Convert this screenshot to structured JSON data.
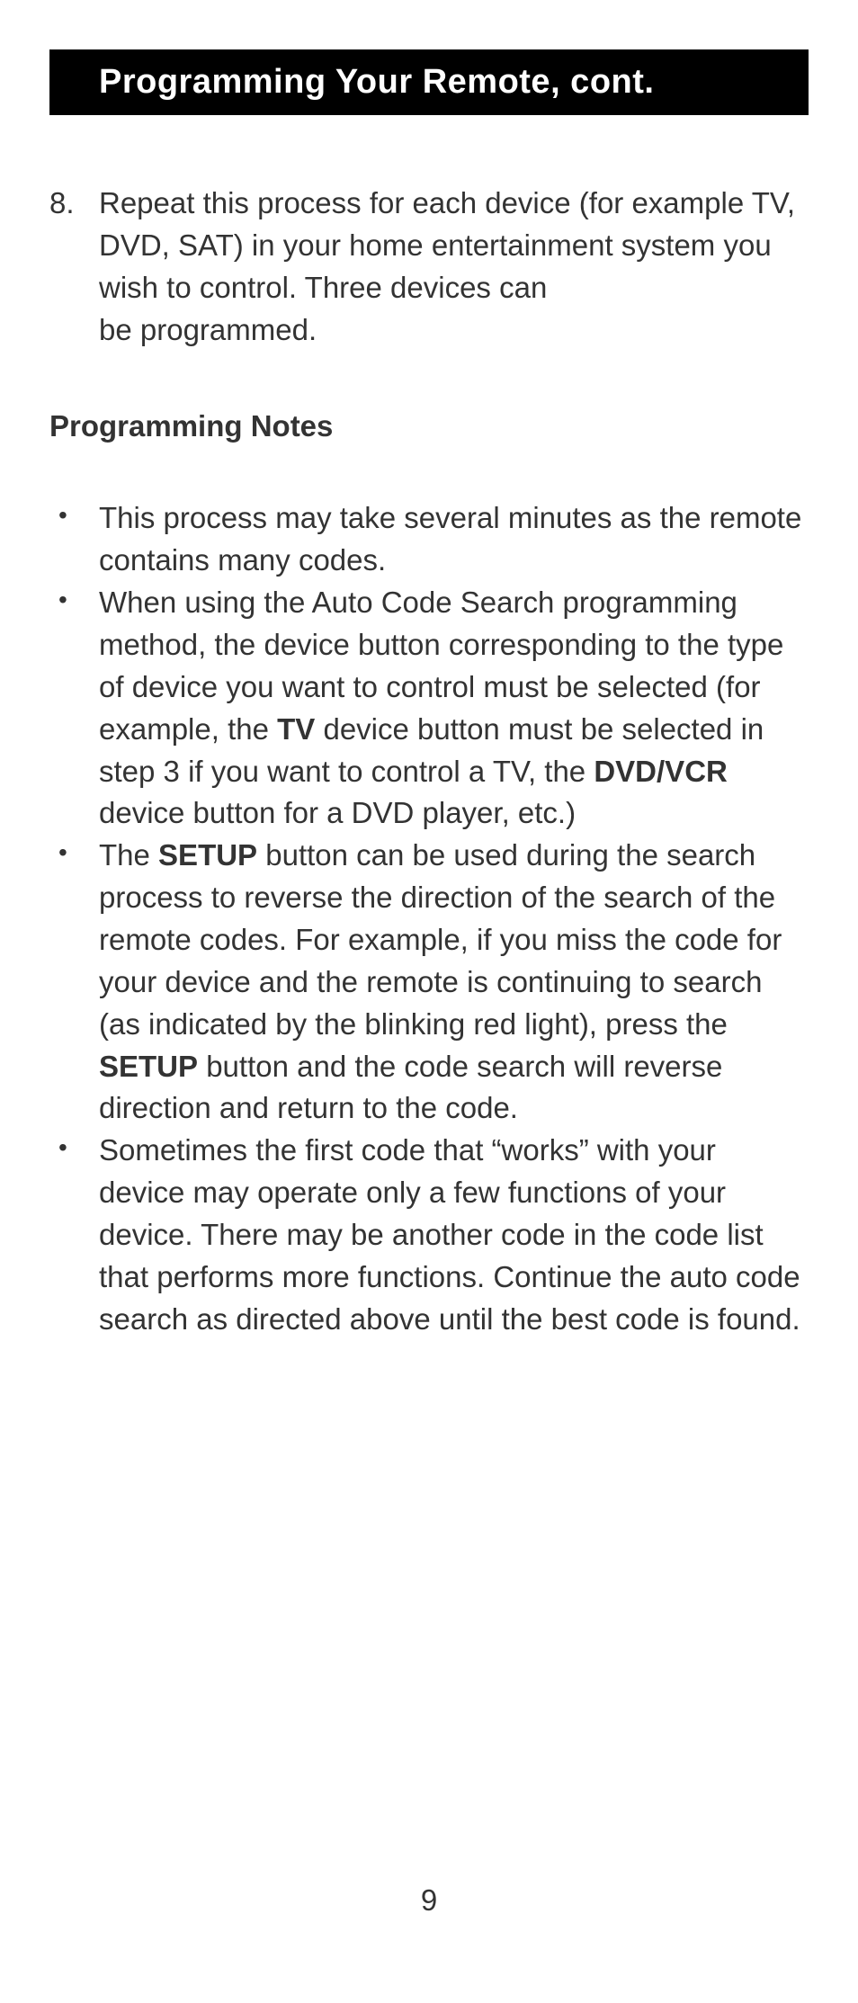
{
  "header": {
    "title": "Programming Your Remote, cont."
  },
  "numbered": {
    "number": "8.",
    "text_line1": "Repeat this process for each device (for example TV, DVD, SAT) in your home entertainment system you wish to control. Three devices can",
    "text_line2": "be programmed."
  },
  "section_title": "Programming Notes",
  "bullets": [
    {
      "parts": [
        {
          "text": "This process may take several minutes as the remote contains many codes.",
          "bold": false
        }
      ]
    },
    {
      "parts": [
        {
          "text": "When using the Auto Code Search programming method, the device button corresponding to the type of device you want to control must be selected (for example, the ",
          "bold": false
        },
        {
          "text": "TV",
          "bold": true
        },
        {
          "text": " device button must be selected in step 3 if you want to control a TV, the ",
          "bold": false
        },
        {
          "text": "DVD/VCR",
          "bold": true
        },
        {
          "text": " device button for a DVD player, etc.)",
          "bold": false
        }
      ]
    },
    {
      "parts": [
        {
          "text": "The ",
          "bold": false
        },
        {
          "text": "SETUP",
          "bold": true
        },
        {
          "text": " button can be used during the search process to reverse the direction of the search of the remote codes. For example, if you miss the code for your device and the remote is continuing to search (as indicated by the blinking red light), press the ",
          "bold": false
        },
        {
          "text": "SETUP",
          "bold": true
        },
        {
          "text": " button and the code search will reverse direction and return to the code.",
          "bold": false
        }
      ]
    },
    {
      "parts": [
        {
          "text": "Sometimes the first code that “works” with your device may operate only a few functions of your device. There may be another code in the code list that performs more functions. Continue the auto code search as directed above until the best code is found.",
          "bold": false
        }
      ]
    }
  ],
  "page_number": "9"
}
